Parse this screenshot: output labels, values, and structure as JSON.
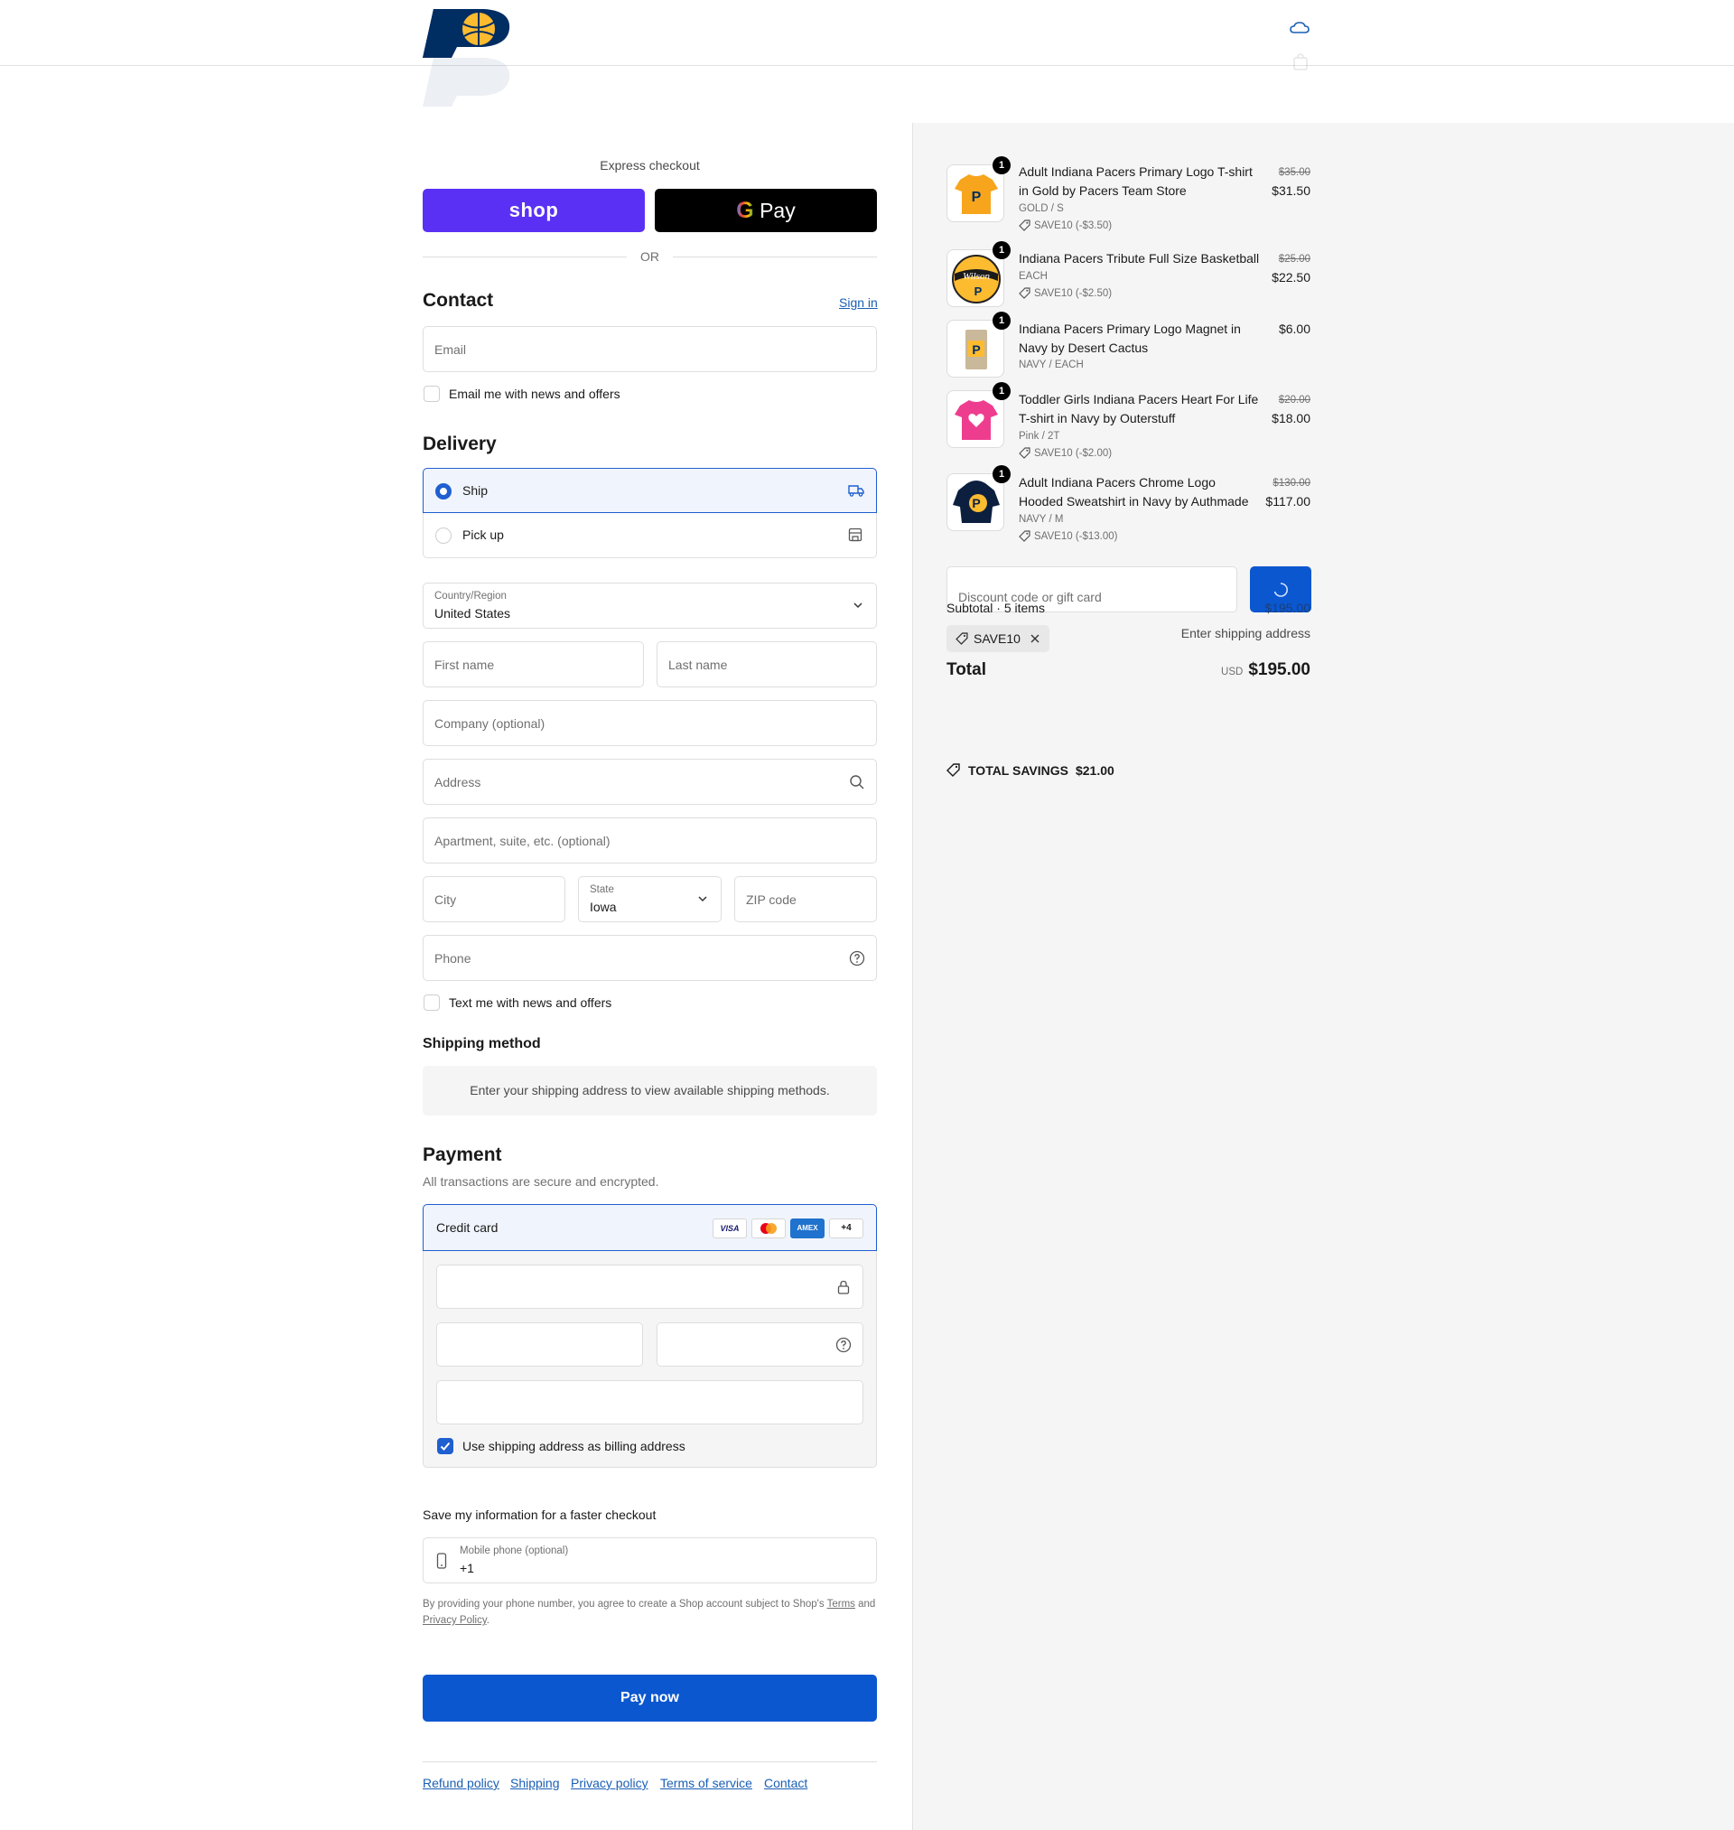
{
  "header": {
    "logo_alt": "Indiana Pacers"
  },
  "express": {
    "title": "Express checkout",
    "shop_label": "shop",
    "gpay_label": "Pay",
    "or_label": "OR"
  },
  "contact": {
    "heading": "Contact",
    "sign_in": "Sign in",
    "email_placeholder": "Email",
    "news_label": "Email me with news and offers"
  },
  "delivery": {
    "heading": "Delivery",
    "options": [
      {
        "label": "Ship",
        "selected": true
      },
      {
        "label": "Pick up",
        "selected": false
      }
    ],
    "country_label": "Country/Region",
    "country_value": "United States",
    "first_name": "First name",
    "last_name": "Last name",
    "company": "Company (optional)",
    "address": "Address",
    "apartment": "Apartment, suite, etc. (optional)",
    "city": "City",
    "state_label": "State",
    "state_value": "Iowa",
    "zip": "ZIP code",
    "phone": "Phone",
    "text_label": "Text me with news and offers"
  },
  "shipping_method": {
    "heading": "Shipping method",
    "notice": "Enter your shipping address to view available shipping methods."
  },
  "payment": {
    "heading": "Payment",
    "subtitle": "All transactions are secure and encrypted.",
    "method": "Credit card",
    "brands": [
      "VISA",
      "MC",
      "AMEX",
      "+4"
    ],
    "billing_label": "Use shipping address as billing address",
    "billing_checked": true
  },
  "save_info": {
    "heading": "Save my information for a faster checkout",
    "mobile_label": "Mobile phone (optional)",
    "mobile_value": "+1",
    "legal_prefix": "By providing your phone number, you agree to create a Shop account subject to Shop's",
    "terms": "Terms",
    "and": "and",
    "privacy": "Privacy Policy",
    "period": "."
  },
  "pay_button": "Pay now",
  "footer": {
    "links": [
      "Refund policy",
      "Shipping",
      "Privacy policy",
      "Terms of service",
      "Contact"
    ]
  },
  "summary": {
    "items": [
      {
        "qty": "1",
        "title": "Adult Indiana Pacers Primary Logo T-shirt in Gold by Pacers Team Store",
        "variant": "GOLD / S",
        "discount": "SAVE10 (-$3.50)",
        "old_price": "$35.00",
        "price": "$31.50"
      },
      {
        "qty": "1",
        "title": "Indiana Pacers Tribute Full Size Basketball",
        "variant": "EACH",
        "discount": "SAVE10 (-$2.50)",
        "old_price": "$25.00",
        "price": "$22.50"
      },
      {
        "qty": "1",
        "title": "Indiana Pacers Primary Logo Magnet in Navy by Desert Cactus",
        "variant": "NAVY / EACH",
        "discount": "",
        "old_price": "",
        "price": "$6.00"
      },
      {
        "qty": "1",
        "title": "Toddler Girls Indiana Pacers Heart For Life T-shirt in Navy by Outerstuff",
        "variant": "Pink / 2T",
        "discount": "SAVE10 (-$2.00)",
        "old_price": "$20.00",
        "price": "$18.00"
      },
      {
        "qty": "1",
        "title": "Adult Indiana Pacers Chrome Logo Hooded Sweatshirt in Navy by Authmade",
        "variant": "NAVY / M",
        "discount": "SAVE10 (-$13.00)",
        "old_price": "$130.00",
        "price": "$117.00"
      }
    ],
    "discount_placeholder": "Discount code or gift card",
    "subtotal_label": "Subtotal · 5 items",
    "subtotal_value": "$195.00",
    "code_tag": "SAVE10",
    "shipping_note": "Enter shipping address",
    "total_label": "Total",
    "currency": "USD",
    "total_value": "$195.00",
    "savings_label": "TOTAL SAVINGS",
    "savings_value": "$21.00"
  },
  "colors": {
    "accent": "#1a5fb4",
    "shop_purple": "#5a31f4",
    "pay_blue": "#0b57d0"
  }
}
